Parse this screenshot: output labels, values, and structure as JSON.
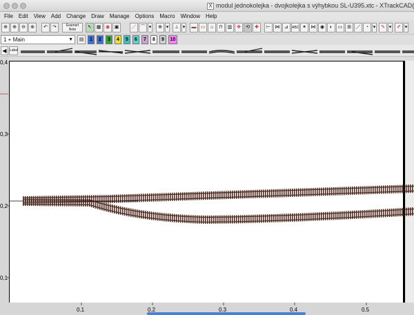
{
  "window": {
    "title": "modul jednokolejka - dvojkolejka s výhybkou SL-U395.xtc - XTrackCAD(5.2.",
    "app_icon": "x-window-icon"
  },
  "menu": [
    "File",
    "Edit",
    "View",
    "Add",
    "Change",
    "Draw",
    "Manage",
    "Options",
    "Macro",
    "Window",
    "Help"
  ],
  "toolbar": {
    "note_button": "Examsrt Note"
  },
  "layers": {
    "current": "1 + Main",
    "buttons": [
      {
        "label": "1",
        "color": "#3a6fd8"
      },
      {
        "label": "2",
        "color": "#3a6fd8"
      },
      {
        "label": "3",
        "color": "#3aa43a"
      },
      {
        "label": "4",
        "color": "#e8e040"
      },
      {
        "label": "5",
        "color": "#40c0c0"
      },
      {
        "label": "6",
        "color": "#60d0d0"
      },
      {
        "label": "7",
        "color": "#d0a0d0"
      },
      {
        "label": "8",
        "color": "#ffffff"
      },
      {
        "label": "9",
        "color": "#d0d0d0"
      },
      {
        "label": "10",
        "color": "#ff80ff"
      }
    ]
  },
  "hotbar": {
    "label": "Label"
  },
  "canvas": {
    "y_ticks": [
      "0,4",
      "0,3",
      "0,2",
      "0,1"
    ],
    "x_ticks": [
      "0.1",
      "0.2",
      "0.3",
      "0.4",
      "0.5"
    ],
    "track_color": "#6b3a2a"
  }
}
